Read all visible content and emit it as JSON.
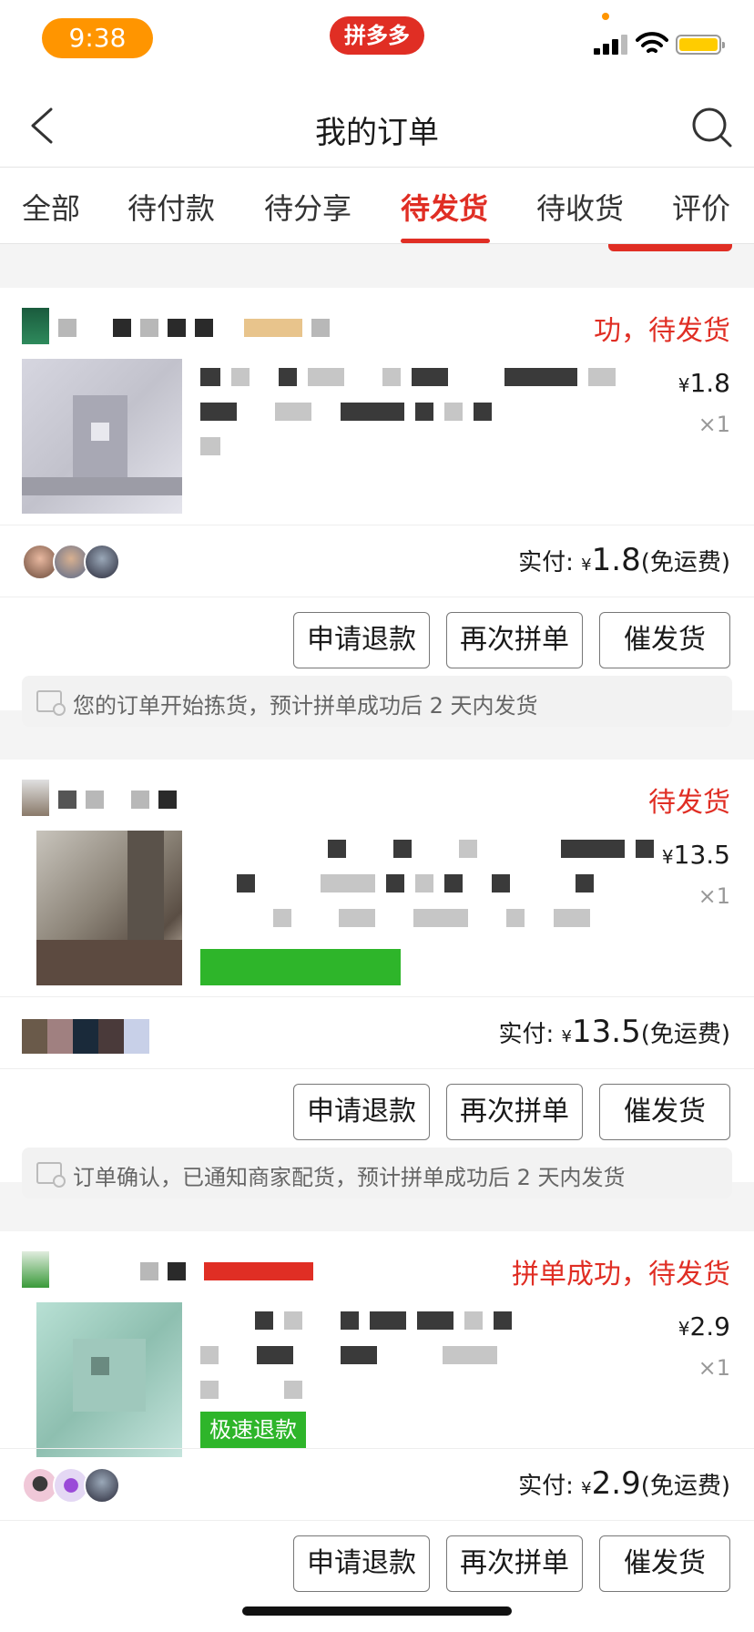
{
  "status_bar": {
    "time": "9:38",
    "app_badge": "拼多多"
  },
  "header": {
    "title": "我的订单"
  },
  "tabs": [
    {
      "label": "全部"
    },
    {
      "label": "待付款"
    },
    {
      "label": "待分享"
    },
    {
      "label": "待发货",
      "active": true
    },
    {
      "label": "待收货"
    },
    {
      "label": "评价"
    }
  ],
  "orders": [
    {
      "status": "功，待发货",
      "price": "1.8",
      "quantity": "×1",
      "paid_label": "实付:",
      "paid_amount": "1.8",
      "shipping": "(免运费)",
      "buttons": [
        "申请退款",
        "再次拼单",
        "催发货"
      ],
      "notice": "您的订单开始拣货，预计拼单成功后 2 天内发货"
    },
    {
      "status": "待发货",
      "price": "13.5",
      "quantity": "×1",
      "paid_label": "实付:",
      "paid_amount": "13.5",
      "shipping": "(免运费)",
      "buttons": [
        "申请退款",
        "再次拼单",
        "催发货"
      ],
      "notice": "订单确认，已通知商家配货，预计拼单成功后 2 天内发货"
    },
    {
      "status": "拼单成功，待发货",
      "price": "2.9",
      "quantity": "×1",
      "tag": "极速退款",
      "paid_label": "实付:",
      "paid_amount": "2.9",
      "shipping": "(免运费)",
      "buttons": [
        "申请退款",
        "再次拼单",
        "催发货"
      ]
    }
  ],
  "currency_symbol": "¥",
  "colors": {
    "accent": "#e02e24",
    "status_pill": "#ff9500",
    "tag_green": "#2eb52a"
  }
}
